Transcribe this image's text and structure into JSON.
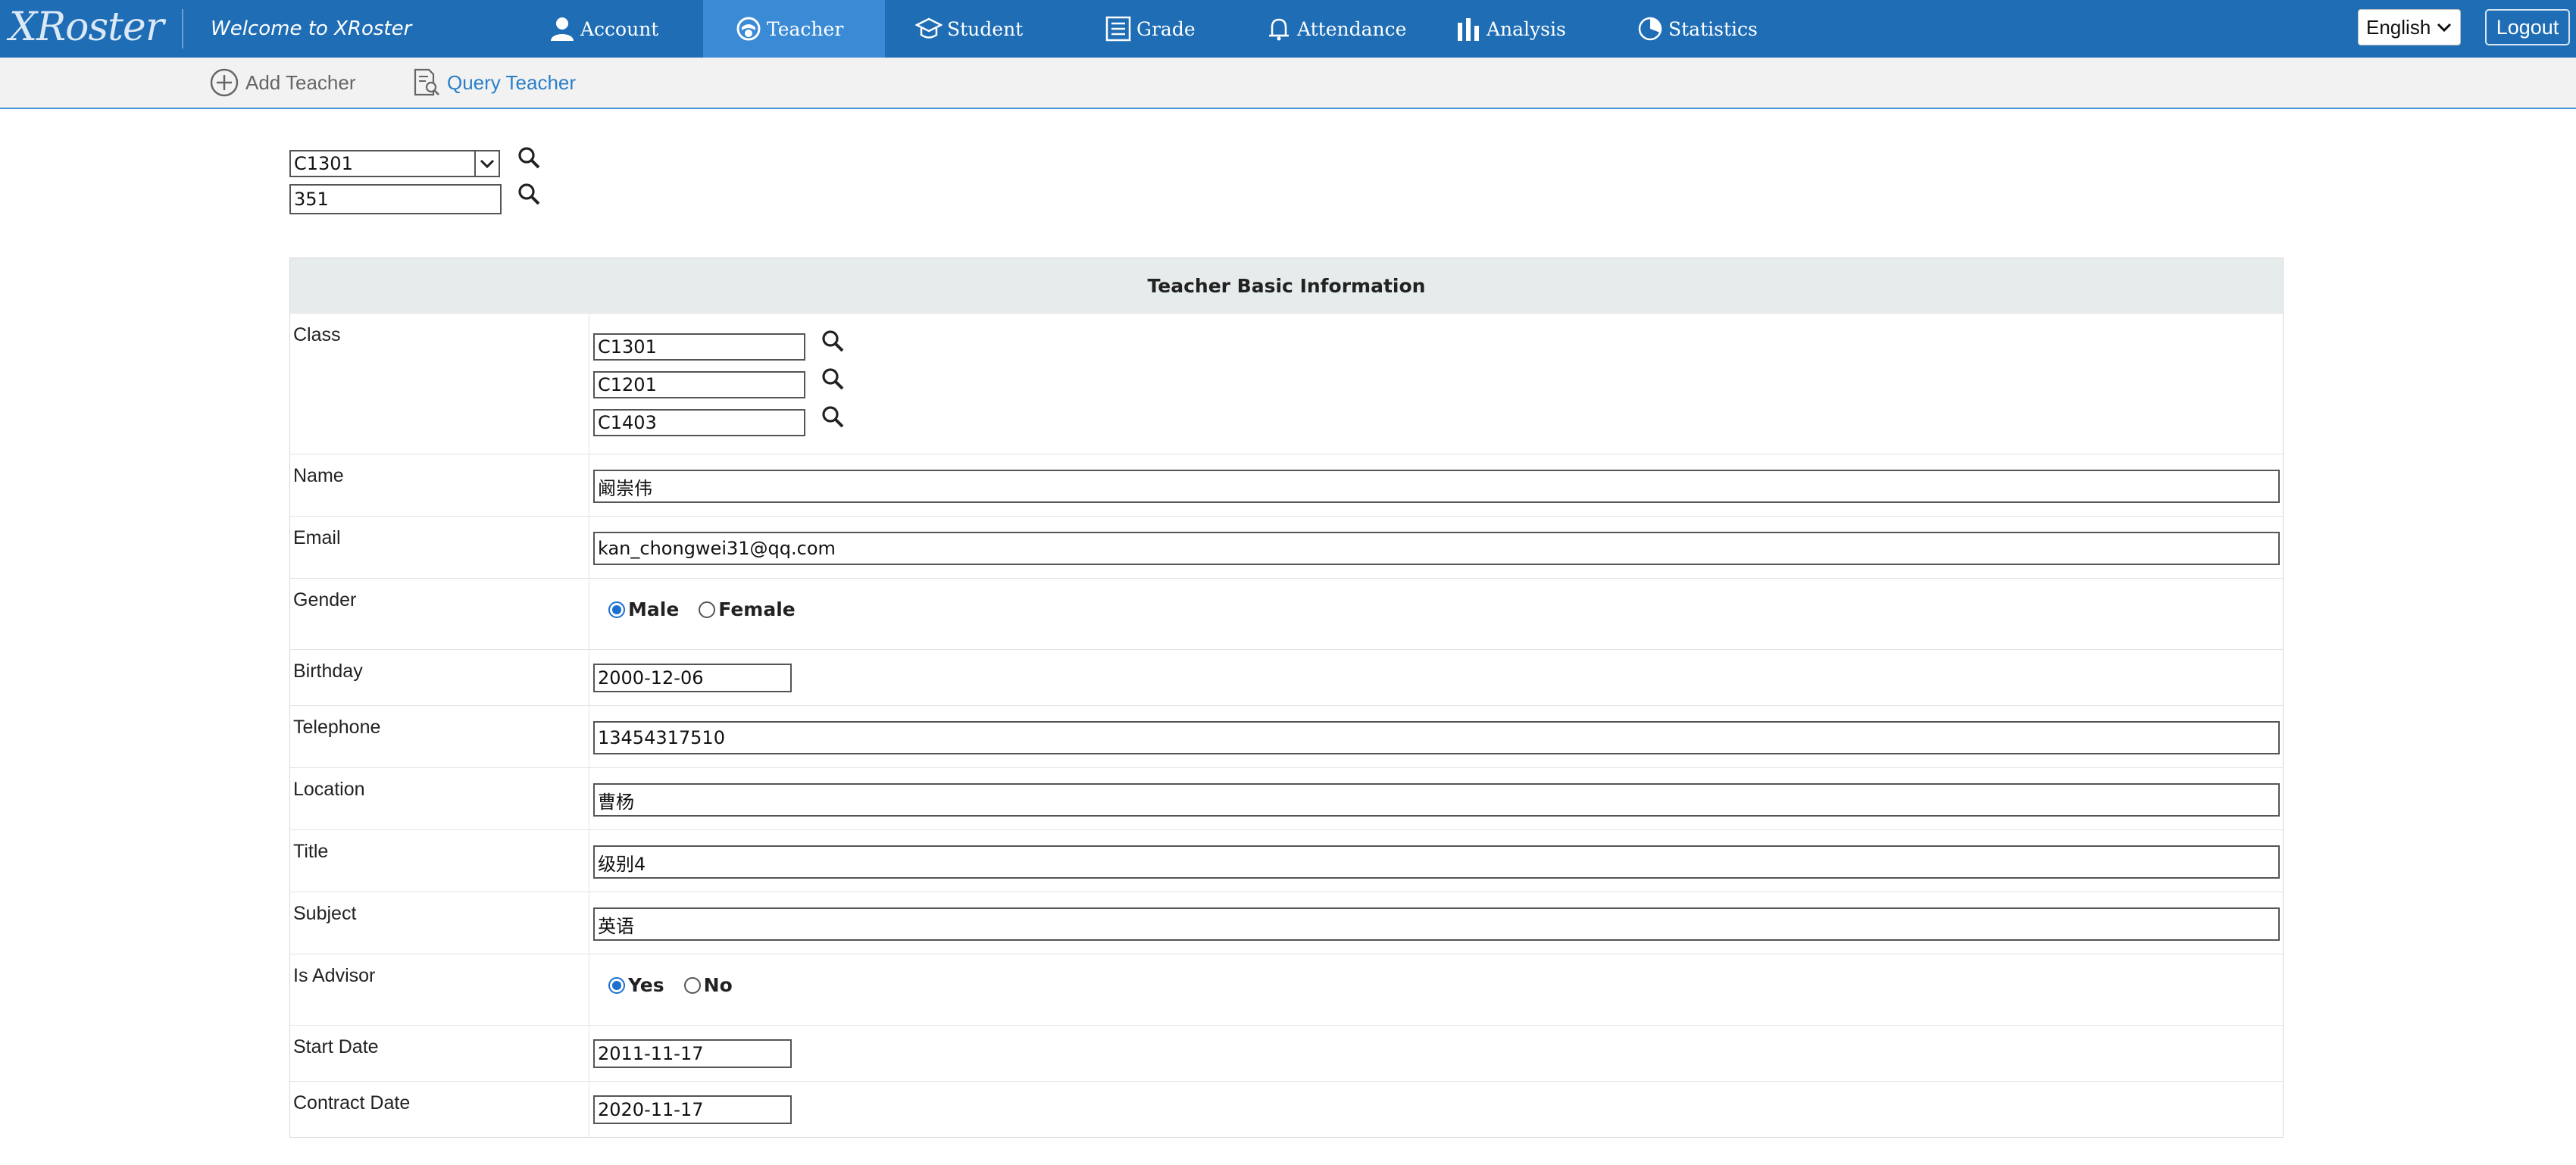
{
  "header": {
    "logo": "XRoster",
    "welcome": "Welcome to XRoster",
    "nav": [
      {
        "label": "Account",
        "icon": "user-icon"
      },
      {
        "label": "Teacher",
        "icon": "teacher-icon",
        "active": true
      },
      {
        "label": "Student",
        "icon": "graduation-cap-icon"
      },
      {
        "label": "Grade",
        "icon": "list-icon"
      },
      {
        "label": "Attendance",
        "icon": "bell-icon"
      },
      {
        "label": "Analysis",
        "icon": "bar-chart-icon"
      },
      {
        "label": "Statistics",
        "icon": "pie-chart-icon"
      }
    ],
    "language": "English",
    "logout": "Logout"
  },
  "subnav": {
    "add": "Add Teacher",
    "query": "Query Teacher"
  },
  "search": {
    "class_value": "C1301",
    "id_value": "351"
  },
  "table": {
    "title": "Teacher Basic Information",
    "labels": {
      "class": "Class",
      "name": "Name",
      "email": "Email",
      "gender": "Gender",
      "birthday": "Birthday",
      "telephone": "Telephone",
      "location": "Location",
      "title": "Title",
      "subject": "Subject",
      "advisor": "Is Advisor",
      "start": "Start Date",
      "contract": "Contract Date"
    },
    "values": {
      "classes": [
        "C1301",
        "C1201",
        "C1403"
      ],
      "name": "阚崇伟",
      "email": "kan_chongwei31@qq.com",
      "gender_options": [
        "Male",
        "Female"
      ],
      "gender_selected": "Male",
      "birthday": "2000-12-06",
      "telephone": "13454317510",
      "location": "曹杨",
      "title": "级别4",
      "subject": "英语",
      "advisor_options": [
        "Yes",
        "No"
      ],
      "advisor_selected": "Yes",
      "start": "2011-11-17",
      "contract": "2020-11-17"
    }
  },
  "colors": {
    "nav_bg": "#1f6db5",
    "nav_active": "#3a8ad6",
    "link_blue": "#2a7fc9",
    "table_header_bg": "#e6ebeb"
  }
}
